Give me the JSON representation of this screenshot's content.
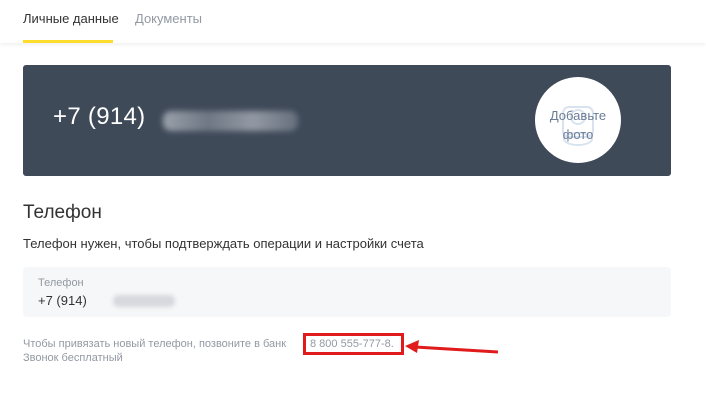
{
  "tabs": [
    {
      "label": "Личные данные",
      "active": true
    },
    {
      "label": "Документы",
      "active": false
    }
  ],
  "banner": {
    "phone_prefix": "+7 (914) ",
    "avatar_label": "Добавьте фото"
  },
  "phone_section": {
    "title": "Телефон",
    "description": "Телефон нужен, чтобы подтверждать операции и настройки счета",
    "field_label": "Телефон",
    "field_value": "+7 (914) "
  },
  "hint": {
    "text_before": "Чтобы привязать новый телефон, позвоните в банк",
    "bank_phone": "8 800 555-777-8.",
    "text_line2": "Звонок бесплатный"
  },
  "colors": {
    "banner": "#3f4a59",
    "tab_accent": "#ffdd2d",
    "highlight": "#e11b1b"
  }
}
